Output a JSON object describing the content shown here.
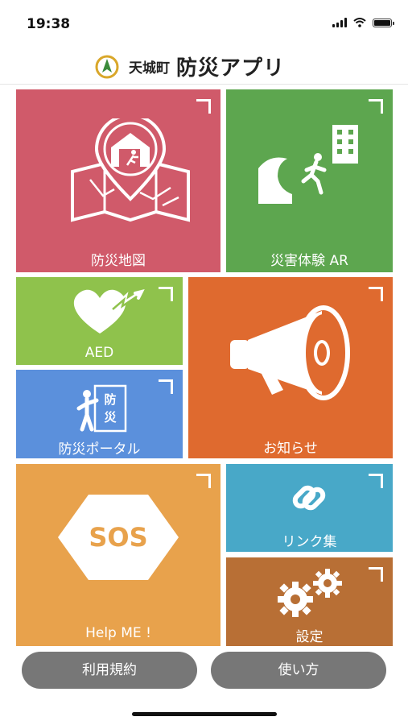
{
  "status_bar": {
    "time": "19:38"
  },
  "header": {
    "town": "天城町",
    "app_name": "防災アプリ"
  },
  "tiles": {
    "bousai_map": {
      "label": "防災地図",
      "color": "#d05a6a"
    },
    "saigai_ar": {
      "label": "災害体験 AR",
      "color": "#5da64f"
    },
    "aed": {
      "label": "AED",
      "color": "#8fc24c"
    },
    "oshirase": {
      "label": "お知らせ",
      "color": "#df6a2f"
    },
    "bousai_portal": {
      "label": "防災ポータル",
      "color": "#5b90dc",
      "icon_sign": [
        "防",
        "災"
      ]
    },
    "help_me": {
      "label": "Help ME !",
      "color": "#e8a24c",
      "icon_text": "SOS"
    },
    "links": {
      "label": "リンク集",
      "color": "#48a8c8"
    },
    "settings": {
      "label": "設定",
      "color": "#b86f35"
    }
  },
  "buttons": {
    "terms": "利用規約",
    "usage": "使い方"
  },
  "icons": [
    "logo-icon",
    "map-icon",
    "evacuation-ar-icon",
    "aed-heart-icon",
    "megaphone-icon",
    "portal-icon",
    "sos-icon",
    "link-icon",
    "gears-icon"
  ]
}
